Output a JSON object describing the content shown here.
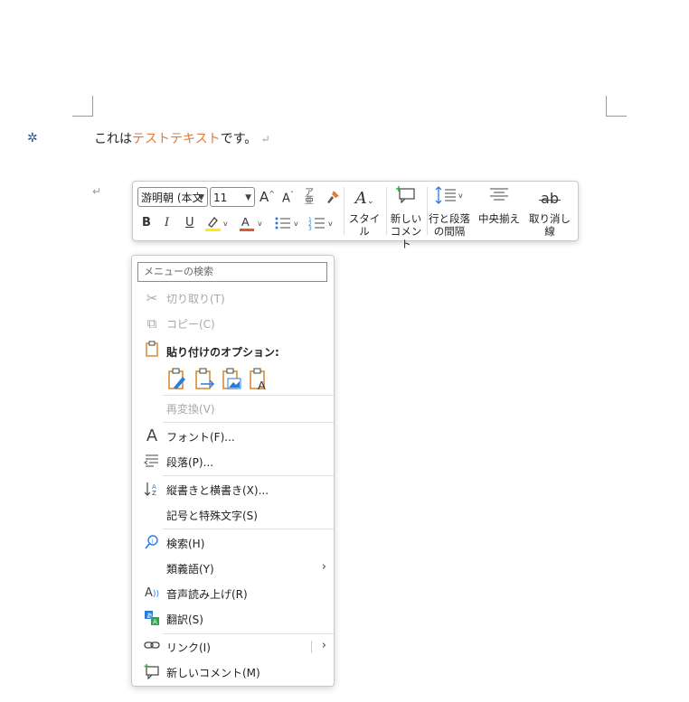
{
  "document": {
    "text_before": "これは",
    "text_highlight": "テストテキスト",
    "text_after": "です。",
    "para_mark": "↵"
  },
  "toolbar": {
    "font_name": "游明朝 (本文",
    "font_size": "11",
    "style_label": "スタイル",
    "new_comment_label": [
      "新しい",
      "コメント"
    ],
    "spacing_label": [
      "行と段落",
      "の間隔"
    ],
    "center_label": "中央揃え",
    "strike_label": "取り消し線",
    "bold": "B",
    "italic": "I",
    "underline": "U",
    "grow": "A",
    "shrink": "A",
    "strike_icon_text": "ab"
  },
  "menu": {
    "search_placeholder": "メニューの検索",
    "items": [
      {
        "label": "切り取り(T)",
        "disabled": true,
        "icon": "scissors-icon"
      },
      {
        "label": "コピー(C)",
        "disabled": true,
        "icon": "copy-icon"
      },
      {
        "label": "貼り付けのオプション:",
        "icon": "paste-icon"
      },
      {
        "label": "再変換(V)",
        "disabled": true
      },
      {
        "label": "フォント(F)...",
        "icon": "font-icon"
      },
      {
        "label": "段落(P)...",
        "icon": "paragraph-icon"
      },
      {
        "label": "縦書きと横書き(X)...",
        "icon": "text-direction-icon"
      },
      {
        "label": "記号と特殊文字(S)"
      },
      {
        "label": "検索(H)",
        "icon": "search-icon"
      },
      {
        "label": "類義語(Y)",
        "submenu": true
      },
      {
        "label": "音声読み上げ(R)",
        "icon": "read-aloud-icon"
      },
      {
        "label": "翻訳(S)",
        "icon": "translate-icon"
      },
      {
        "label": "リンク(I)",
        "icon": "link-icon",
        "submenu": true
      },
      {
        "label": "新しいコメント(M)",
        "icon": "comment-icon"
      }
    ]
  },
  "colors": {
    "accent_text": "#e07b39",
    "highlight_bar": "#ffee00",
    "font_color_bar": "#e0572a",
    "paste_orange": "#d9822b",
    "paste_blue": "#2b7bd9"
  }
}
